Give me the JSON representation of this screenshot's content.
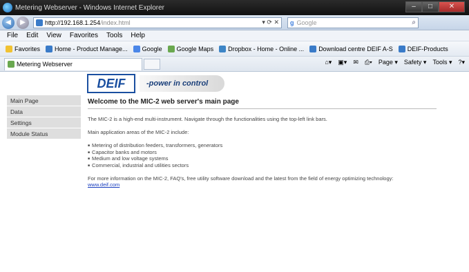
{
  "window": {
    "title": "Metering Webserver - Windows Internet Explorer",
    "minimize": "‒",
    "maximize": "□",
    "close": "✕"
  },
  "address": {
    "host": "http://192.168.1.254",
    "path": "/index.html",
    "search_placeholder": "Google"
  },
  "menu": [
    "File",
    "Edit",
    "View",
    "Favorites",
    "Tools",
    "Help"
  ],
  "favorites": {
    "label": "Favorites",
    "items": [
      "Home - Product Manage...",
      "Google",
      "Google Maps",
      "Dropbox - Home - Online ...",
      "Download centre DEIF A-S",
      "DEIF-Products"
    ]
  },
  "tab": {
    "label": "Metering Webserver"
  },
  "commands": [
    "Page ▾",
    "Safety ▾",
    "Tools ▾"
  ],
  "logo": {
    "brand": "DEIF",
    "slogan": "-power in control"
  },
  "sidebar": [
    "Main Page",
    "Data",
    "Settings",
    "Module Status"
  ],
  "main": {
    "title": "Welcome to the MIC-2 web server's main page",
    "intro": "The MIC-2 is a high-end multi-instrument. Navigate through the functionalities using the top-left link bars.",
    "areas_heading": "Main application areas of the MIC-2 include:",
    "areas": [
      "Metering of distribution feeders, transformers, generators",
      "Capacitor banks and motors",
      "Medium and low voltage systems",
      "Commercial, industrial and utilities sectors"
    ],
    "more_info": "For more information on the MIC-2, FAQ's, free utility software download and the latest from the field of energy optimizing technology:",
    "link": "www.deif.com"
  }
}
